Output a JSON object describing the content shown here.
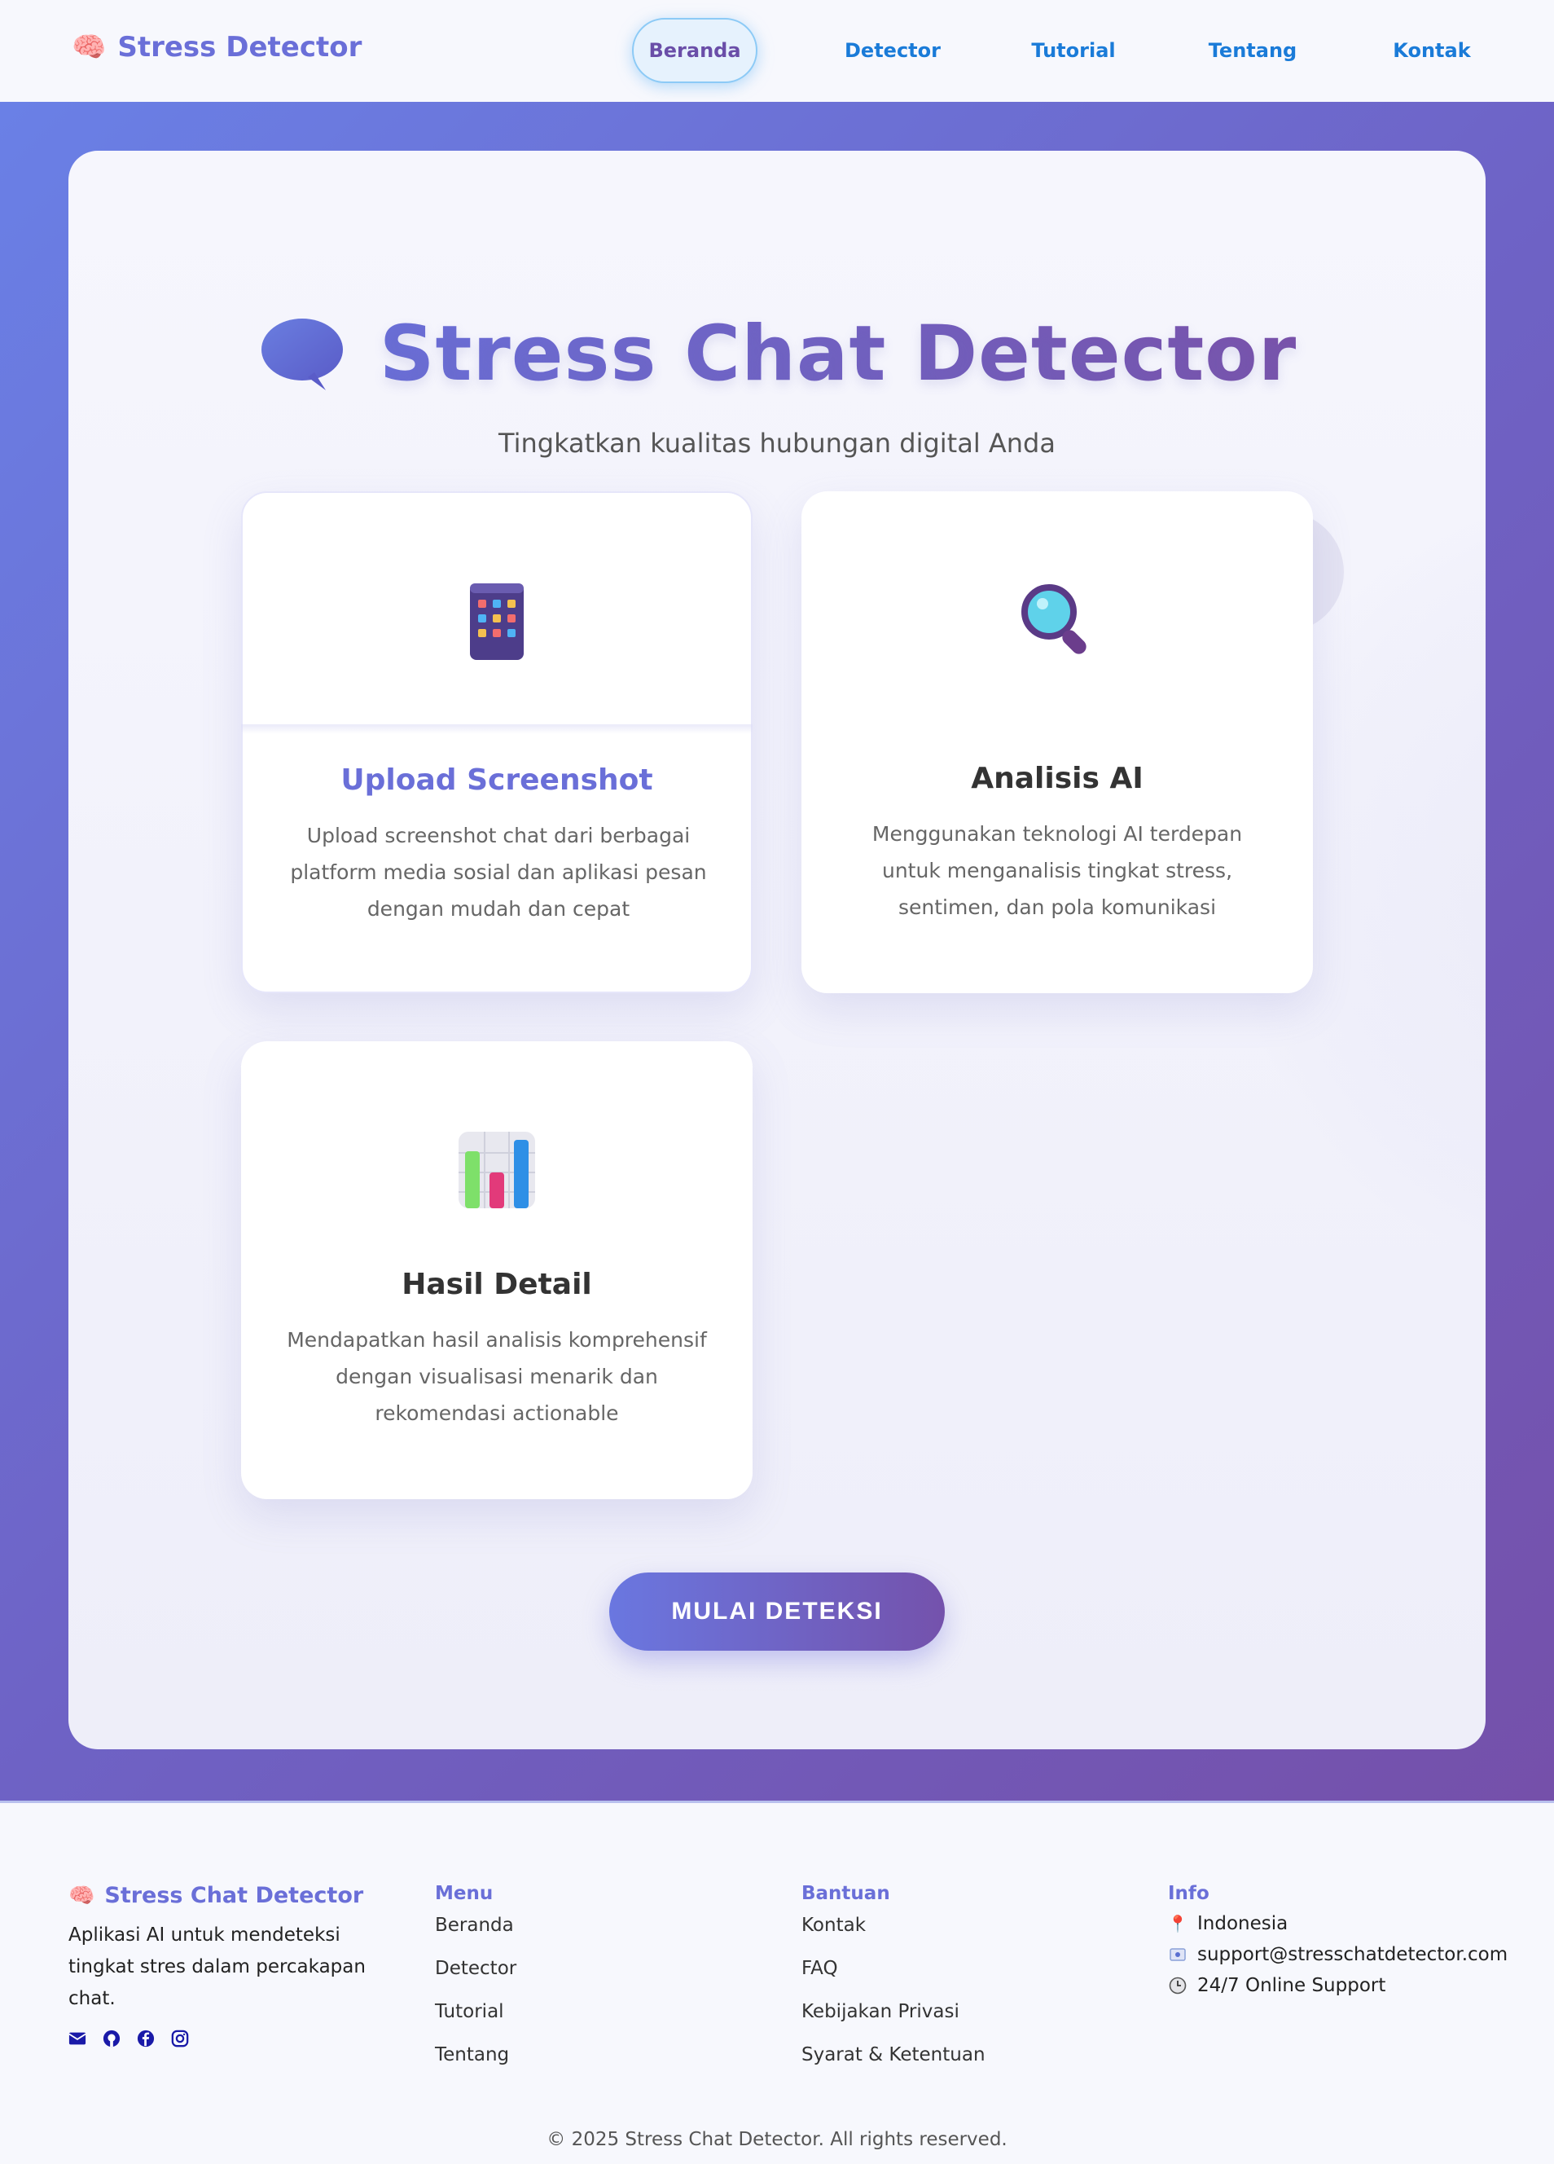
{
  "navbar": {
    "brand_icon": "brain-icon",
    "brand": "Stress Detector",
    "links": [
      {
        "label": "Beranda",
        "active": true
      },
      {
        "label": "Detector"
      },
      {
        "label": "Tutorial"
      },
      {
        "label": "Tentang"
      },
      {
        "label": "Kontak"
      }
    ]
  },
  "hero": {
    "title_icon": "chat-bubble-icon",
    "title": "Stress Chat Detector",
    "subtitle": "Tingkatkan kualitas hubungan digital Anda",
    "cards": [
      {
        "icon": "mobile-phone-icon",
        "title": "Upload Screenshot",
        "desc": "Upload screenshot chat dari berbagai platform media sosial dan aplikasi pesan dengan mudah dan cepat"
      },
      {
        "icon": "magnifier-icon",
        "title": "Analisis AI",
        "desc": "Menggunakan teknologi AI terdepan untuk menganalisis tingkat stress, sentimen, dan pola komunikasi"
      },
      {
        "icon": "bar-chart-icon",
        "title": "Hasil Detail",
        "desc": "Mendapatkan hasil analisis komprehensif dengan visualisasi menarik dan rekomendasi actionable"
      }
    ],
    "cta": "MULAI DETEKSI"
  },
  "footer": {
    "brand": "Stress Chat Detector",
    "desc": "Aplikasi AI untuk mendeteksi tingkat stres dalam percakapan chat.",
    "socials": [
      "envelope-icon",
      "github-icon",
      "facebook-icon",
      "instagram-icon"
    ],
    "menu": {
      "heading": "Menu",
      "items": [
        "Beranda",
        "Detector",
        "Tutorial",
        "Tentang"
      ]
    },
    "help": {
      "heading": "Bantuan",
      "items": [
        "Kontak",
        "FAQ",
        "Kebijakan Privasi",
        "Syarat & Ketentuan"
      ]
    },
    "info": {
      "heading": "Info",
      "items": [
        {
          "icon": "pin-icon",
          "text": "Indonesia"
        },
        {
          "icon": "email-icon",
          "text": "support@stresschatdetector.com"
        },
        {
          "icon": "clock-icon",
          "text": "24/7 Online Support"
        }
      ]
    },
    "copyright": "© 2025 Stress Chat Detector. All rights reserved."
  },
  "colors": {
    "brand": "#6a6fd8",
    "nav_link": "#1a7bd8",
    "gradient_start": "#6a80e6",
    "gradient_end": "#7550aa"
  }
}
